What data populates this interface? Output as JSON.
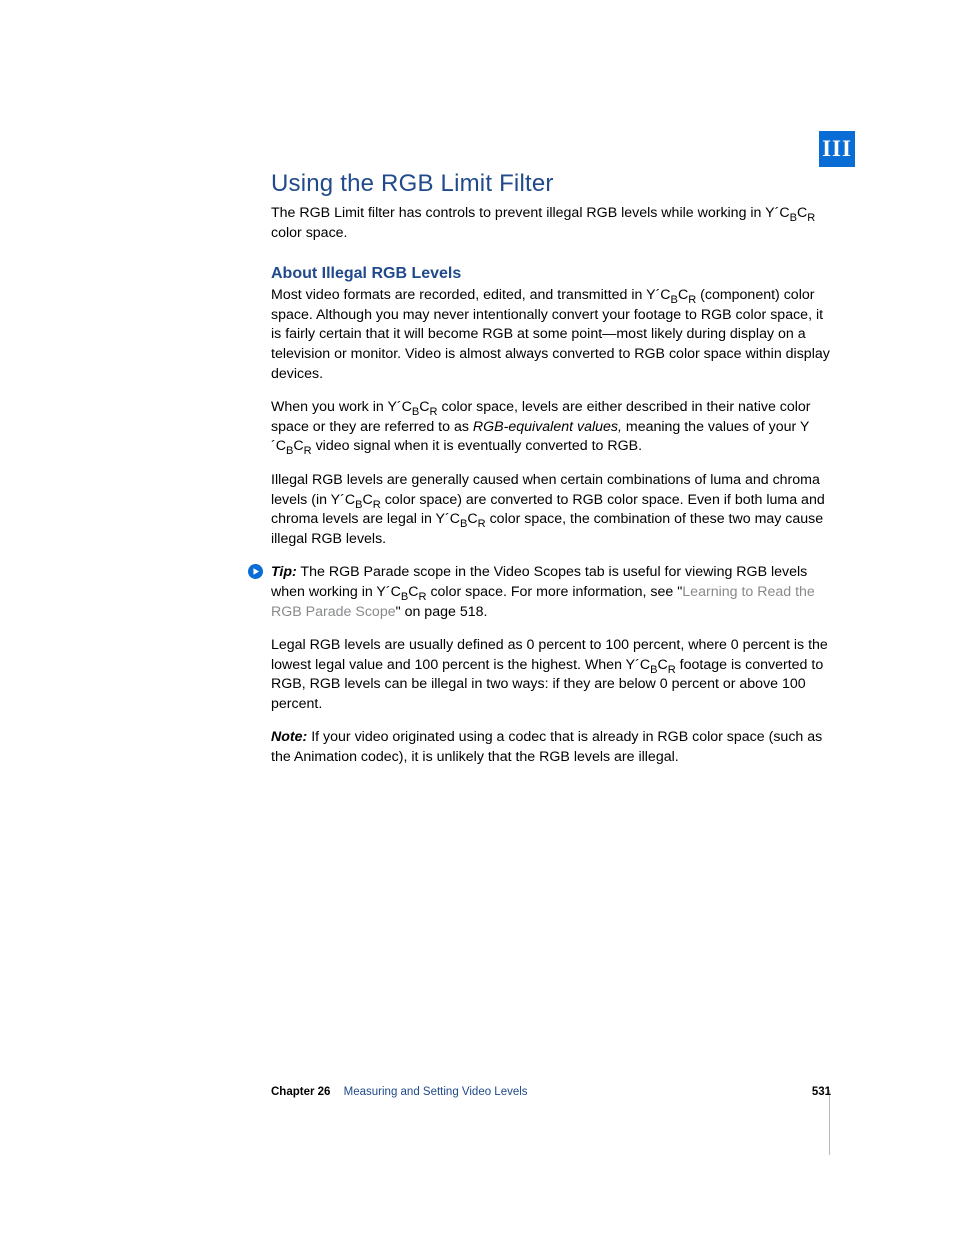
{
  "part_tab": "III",
  "heading": "Using the RGB Limit Filter",
  "intro": {
    "pre": "The RGB Limit filter has controls to prevent illegal RGB levels while working in Y´C",
    "post": " color space."
  },
  "subheading": "About Illegal RGB Levels",
  "para1": {
    "pre": "Most video formats are recorded, edited, and transmitted in Y´C",
    "post": " (component) color space. Although you may never intentionally convert your footage to RGB color space, it is fairly certain that it will become RGB at some point—most likely during display on a television or monitor. Video is almost always converted to RGB color space within display devices."
  },
  "para2": {
    "p1_pre": "When you work in Y´C",
    "p1_post": " color space, levels are either described in their native color space or they are referred to as ",
    "italic": "RGB-equivalent values,",
    "p2_pre": " meaning the values of your Y´C",
    "p2_post": " video signal when it is eventually converted to RGB."
  },
  "para3": {
    "p1_pre": "Illegal RGB levels are generally caused when certain combinations of luma and chroma levels (in Y´C",
    "p1_post": " color space) are converted to RGB color space. Even if both luma and chroma levels are legal in Y´C",
    "p2_post": " color space, the combination of these two may cause illegal RGB levels."
  },
  "tip": {
    "label": "Tip:",
    "p1_pre": "  The RGB Parade scope in the Video Scopes tab is useful for viewing RGB levels when working in Y´C",
    "p1_post": " color space. For more information, see \"",
    "link": "Learning to Read the RGB Parade Scope",
    "tail": "\" on page 518."
  },
  "para4": {
    "pre": "Legal RGB levels are usually defined as 0 percent to 100 percent, where 0 percent is the lowest legal value and 100 percent is the highest. When Y´C",
    "post": " footage is converted to RGB, RGB levels can be illegal in two ways: if they are below 0 percent or above 100 percent."
  },
  "note": {
    "label": "Note:",
    "text": "  If your video originated using a codec that is already in RGB color space (such as the Animation codec), it is unlikely that the RGB levels are illegal."
  },
  "footer": {
    "chapter_label": "Chapter 26",
    "chapter_title": "Measuring and Setting Video Levels",
    "page": "531"
  },
  "sub": {
    "b": "B",
    "r": "R"
  }
}
